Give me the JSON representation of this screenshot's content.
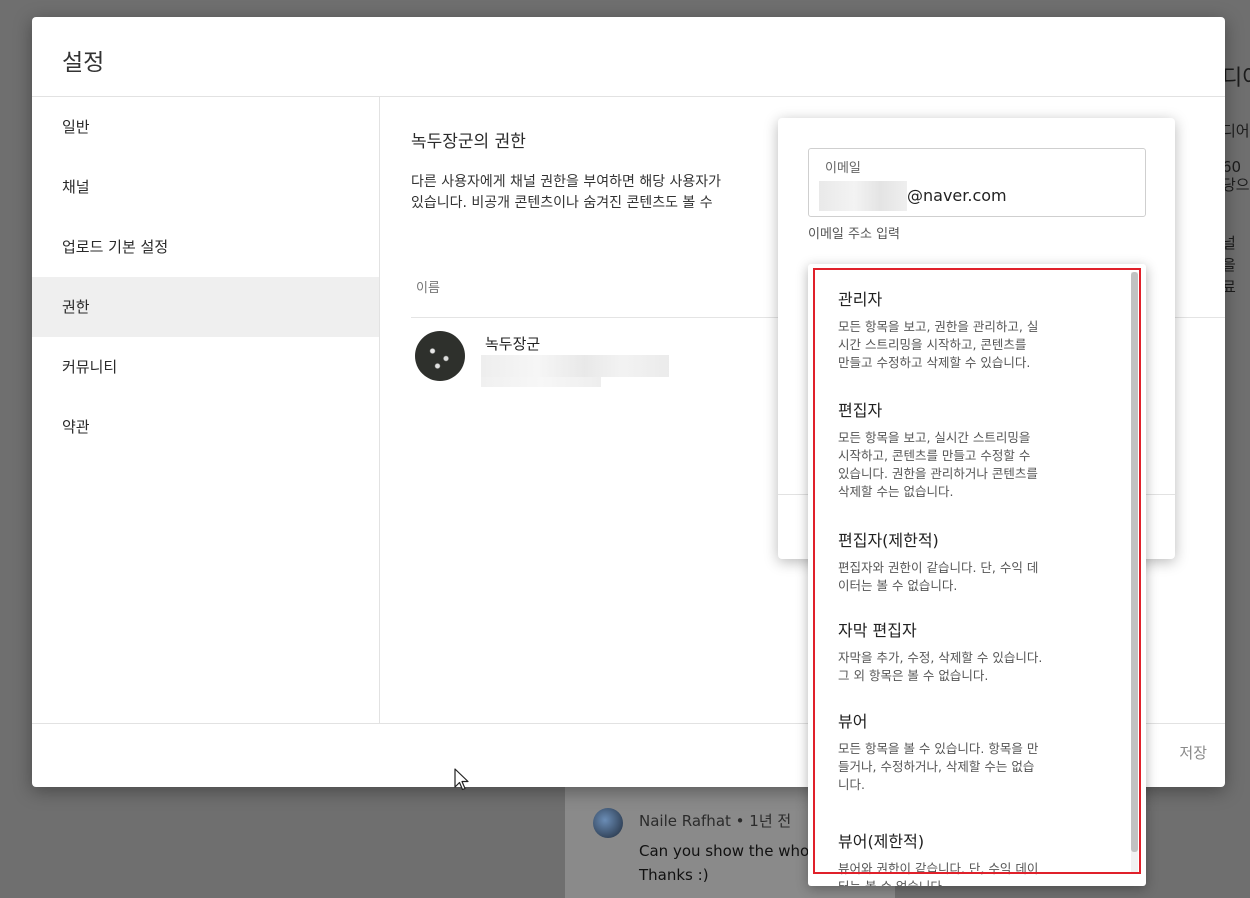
{
  "background": {
    "edge_text": [
      "디어",
      "디어",
      "60",
      "당으",
      "널",
      "을",
      "료"
    ],
    "comment": {
      "author": "Naile Rafhat • 1년 전",
      "lines": [
        "Can you show the whole",
        "Thanks :)"
      ]
    }
  },
  "dialog": {
    "title": "설정",
    "sidebar": {
      "items": [
        {
          "label": "일반"
        },
        {
          "label": "채널"
        },
        {
          "label": "업로드 기본 설정"
        },
        {
          "label": "권한"
        },
        {
          "label": "커뮤니티"
        },
        {
          "label": "약관"
        }
      ],
      "active_index": 3
    },
    "content": {
      "title": "녹두장군의 권한",
      "desc_line1": "다른 사용자에게 채널 권한을 부여하면 해당 사용자가",
      "desc_line2": "있습니다. 비공개 콘텐츠이나 숨겨진 콘텐츠도 볼 수",
      "column_name": "이름",
      "member_name": "녹두장군"
    },
    "footer": {
      "save_label": "저장"
    }
  },
  "invite": {
    "email_label": "이메일",
    "email_value": "@naver.com",
    "email_helper": "이메일 주소 입력"
  },
  "roles": [
    {
      "name": "관리자",
      "desc": [
        "모든 항목을 보고, 권한을 관리하고, 실",
        "시간 스트리밍을 시작하고, 콘텐츠를",
        "만들고 수정하고 삭제할 수 있습니다."
      ]
    },
    {
      "name": "편집자",
      "desc": [
        "모든 항목을 보고, 실시간 스트리밍을",
        "시작하고, 콘텐츠를 만들고 수정할 수",
        "있습니다. 권한을 관리하거나 콘텐츠를",
        "삭제할 수는 없습니다."
      ]
    },
    {
      "name": "편집자(제한적)",
      "desc": [
        "편집자와 권한이 같습니다. 단, 수익 데",
        "이터는 볼 수 없습니다."
      ]
    },
    {
      "name": "자막 편집자",
      "desc": [
        "자막을 추가, 수정, 삭제할 수 있습니다.",
        "그 외 항목은 볼 수 없습니다."
      ]
    },
    {
      "name": "뷰어",
      "desc": [
        "모든 항목을 볼 수 있습니다. 항목을 만",
        "들거나, 수정하거나, 삭제할 수는 없습",
        "니다."
      ]
    },
    {
      "name": "뷰어(제한적)",
      "desc": [
        "뷰어와 권한이 같습니다. 단, 수익 데이",
        "터는 볼 수 없습니다."
      ]
    }
  ],
  "colors": {
    "highlight": "#e0202a",
    "active_bg": "#efefef"
  }
}
